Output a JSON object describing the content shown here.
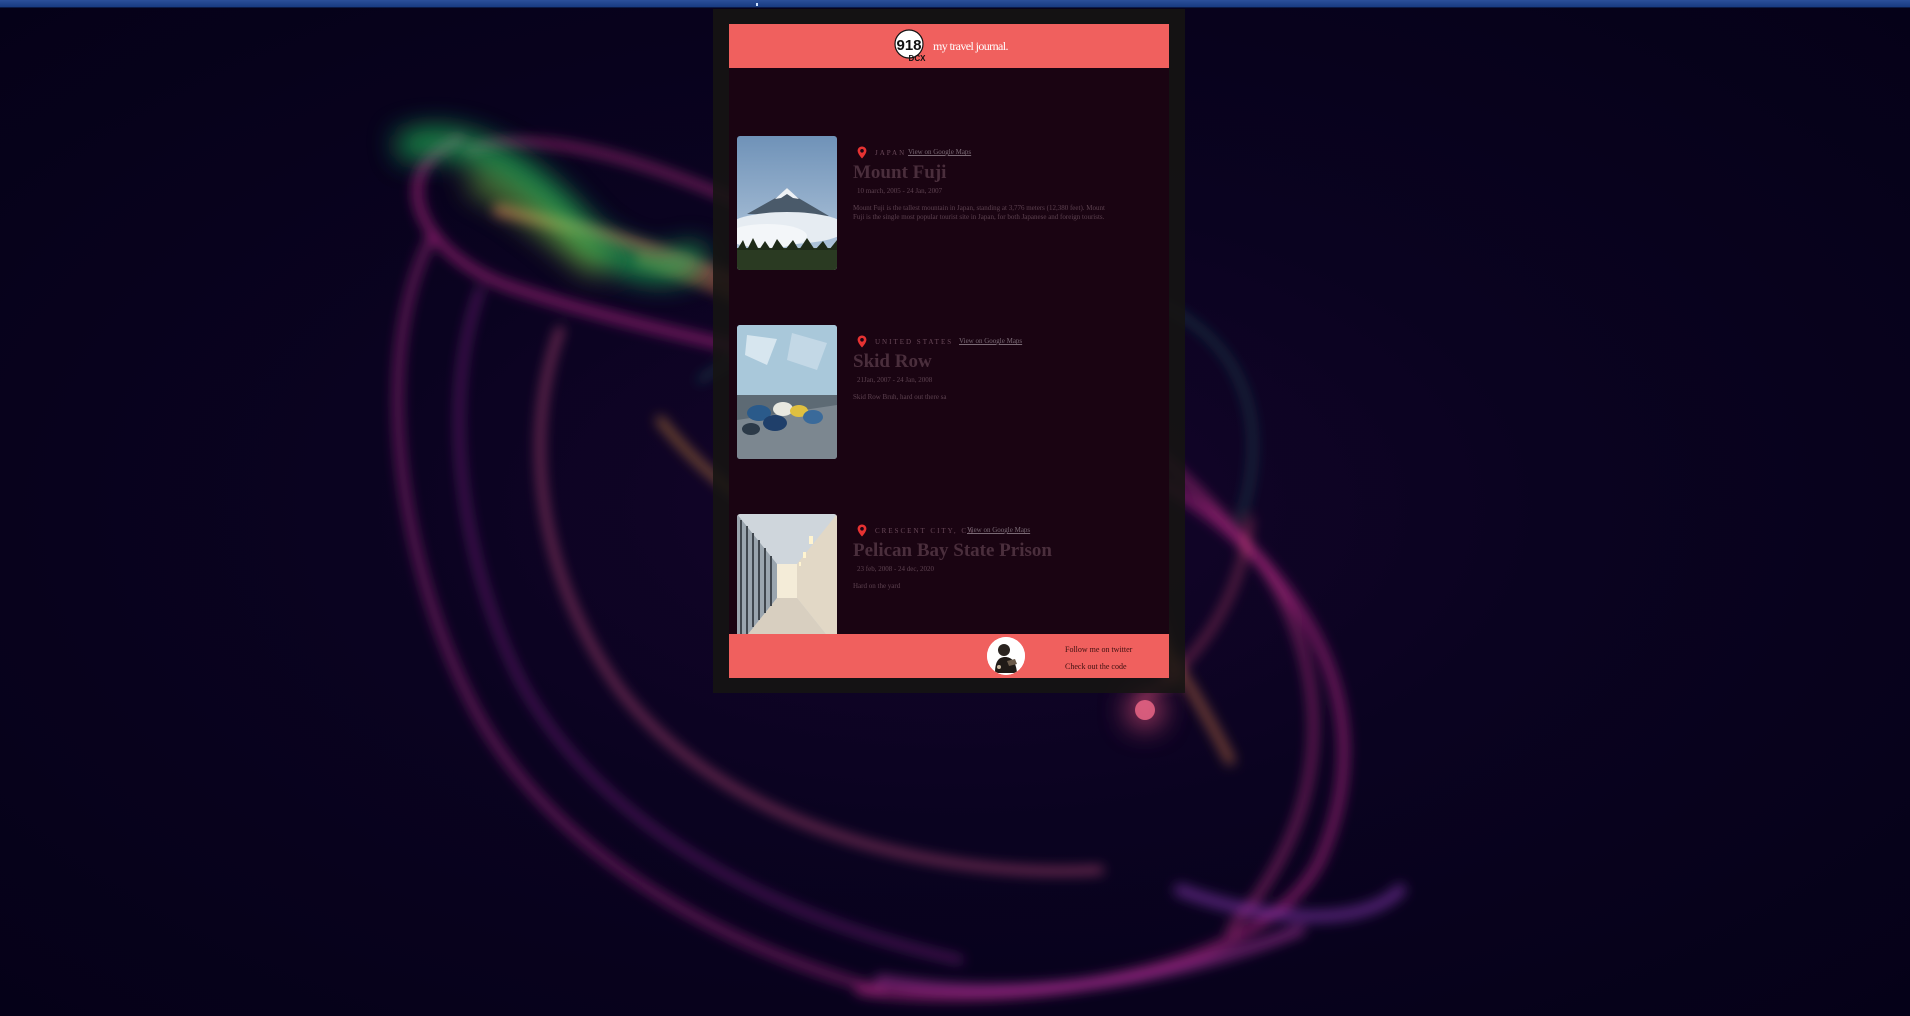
{
  "colors": {
    "accent": "#f0605e",
    "panel": "#1b0515",
    "frame": "#161412",
    "pin": "#e63232"
  },
  "header": {
    "logo_text": "918",
    "logo_sub": "DCX",
    "title": "my travel journal."
  },
  "entries": [
    {
      "country": "Japan",
      "maps_label": "View on Google Maps",
      "title": "Mount Fuji",
      "dates": "10 march, 2005 - 24 Jan, 2007",
      "description": "Mount Fuji is the tallest mountain in Japan, standing at 3,776 meters (12,380 feet). Mount Fuji is the single most popular tourist site in Japan, for both Japanese and foreign tourists.",
      "image_icon": "mountain-icon"
    },
    {
      "country": "United States",
      "maps_label": "View on Google Maps",
      "title": "Skid Row",
      "dates": "21Jan, 2007 - 24 Jan, 2008",
      "description": "Skid Row Bruh, hard out there sa",
      "image_icon": "street-icon"
    },
    {
      "country": "Crescent City, CA",
      "maps_label": "View on Google Maps",
      "title": "Pelican Bay State Prison",
      "dates": "23 feb, 2008 - 24 dec, 2020",
      "description": "Hard on the yard",
      "image_icon": "corridor-icon"
    }
  ],
  "footer": {
    "twitter_label": "Follow me on twitter",
    "code_label": "Check out the code",
    "avatar_icon": "avatar-icon"
  }
}
